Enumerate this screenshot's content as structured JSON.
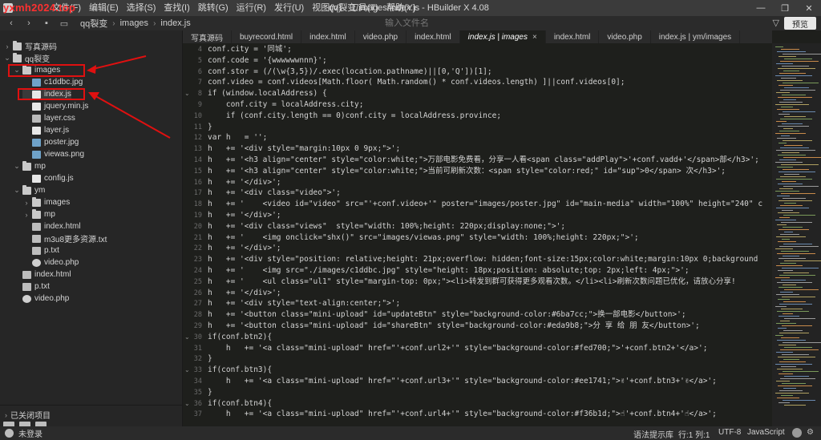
{
  "titlebar": {
    "watermark": "yxmh2024.top",
    "menu": [
      "文件(F)",
      "编辑(E)",
      "选择(S)",
      "查找(I)",
      "跳转(G)",
      "运行(R)",
      "发行(U)",
      "视图(V)",
      "工具(T)",
      "帮助(Y)"
    ],
    "window_title": "qq裂变/images/index.js - HBuilder X 4.08",
    "buttons": [
      "—",
      "❐",
      "✕"
    ]
  },
  "toolbar": {
    "breadcrumb": [
      "qq裂变",
      "images",
      "index.js"
    ],
    "file_input_placeholder": "输入文件名",
    "preview_label": "预览"
  },
  "sidebar": {
    "items": [
      {
        "label": "写真源码",
        "type": "folder",
        "expanded": false,
        "indent": 0
      },
      {
        "label": "qq裂变",
        "type": "folder",
        "expanded": true,
        "indent": 0
      },
      {
        "label": "images",
        "type": "folder",
        "expanded": true,
        "indent": 1
      },
      {
        "label": "c1ddbc.jpg",
        "type": "img",
        "indent": 2
      },
      {
        "label": "index.js",
        "type": "js",
        "indent": 2,
        "selected": true
      },
      {
        "label": "jquery.min.js",
        "type": "js",
        "indent": 2
      },
      {
        "label": "layer.css",
        "type": "css",
        "indent": 2
      },
      {
        "label": "layer.js",
        "type": "js",
        "indent": 2
      },
      {
        "label": "poster.jpg",
        "type": "img",
        "indent": 2
      },
      {
        "label": "viewas.png",
        "type": "img",
        "indent": 2
      },
      {
        "label": "mp",
        "type": "folder",
        "expanded": true,
        "indent": 1
      },
      {
        "label": "config.js",
        "type": "js",
        "indent": 2
      },
      {
        "label": "ym",
        "type": "folder",
        "expanded": true,
        "indent": 1
      },
      {
        "label": "images",
        "type": "folder",
        "expanded": false,
        "indent": 2
      },
      {
        "label": "mp",
        "type": "folder",
        "expanded": false,
        "indent": 2
      },
      {
        "label": "index.html",
        "type": "html",
        "indent": 2
      },
      {
        "label": "m3u8更多资源.txt",
        "type": "txt",
        "indent": 2
      },
      {
        "label": "p.txt",
        "type": "txt",
        "indent": 2
      },
      {
        "label": "video.php",
        "type": "php",
        "indent": 2
      },
      {
        "label": "index.html",
        "type": "html",
        "indent": 1
      },
      {
        "label": "p.txt",
        "type": "txt",
        "indent": 1
      },
      {
        "label": "video.php",
        "type": "php",
        "indent": 1
      }
    ],
    "closed_projects": "已关闭项目"
  },
  "tabs": [
    {
      "label": "写真源码",
      "active": false
    },
    {
      "label": "buyrecord.html",
      "active": false
    },
    {
      "label": "index.html",
      "active": false
    },
    {
      "label": "video.php",
      "active": false
    },
    {
      "label": "index.html",
      "active": false
    },
    {
      "label": "index.js | images",
      "active": true
    },
    {
      "label": "index.html",
      "active": false
    },
    {
      "label": "video.php",
      "active": false
    },
    {
      "label": "index.js | ym/images",
      "active": false
    }
  ],
  "editor": {
    "lines": [
      {
        "n": 4,
        "text": "conf.city = '同城';"
      },
      {
        "n": 5,
        "text": "conf.code = '{wwwwwwnnn}';"
      },
      {
        "n": 6,
        "text": "conf.stor = (/(\\w{3,5})/.exec(location.pathname)||[0,'Q'])[1];"
      },
      {
        "n": 7,
        "text": "conf.video = conf.videos[Math.floor( Math.random() * conf.videos.length) ]||conf.videos[0];"
      },
      {
        "n": 8,
        "text": "if (window.localAddress) {",
        "fold": true
      },
      {
        "n": 9,
        "text": "    conf.city = localAddress.city;"
      },
      {
        "n": 10,
        "text": "    if (conf.city.length == 0)conf.city = localAddress.province;"
      },
      {
        "n": 11,
        "text": "}"
      },
      {
        "n": 12,
        "text": "var h   = '';"
      },
      {
        "n": 13,
        "text": "h   += '<div style=\"margin:10px 0 9px;\">';"
      },
      {
        "n": 14,
        "text": "h   += '<h3 align=\"center\" style=\"color:white;\">万部电影免费看，分享一人看<span class=\"addPlay\">'+conf.vadd+'</span>部</h3>';"
      },
      {
        "n": 15,
        "text": "h   += '<h3 align=\"center\" style=\"color:white;\">当前可刷新次数：<span style=\"color:red;\" id=\"sup\">0</span> 次</h3>';"
      },
      {
        "n": 16,
        "text": "h   += '</div>';"
      },
      {
        "n": 17,
        "text": "h   += '<div class=\"video\">';"
      },
      {
        "n": 18,
        "text": "h   += '    <video id=\"video\" src=\"'+conf.video+'\" poster=\"images/poster.jpg\" id=\"main-media\" width=\"100%\" height=\"240\" c"
      },
      {
        "n": 19,
        "text": "h   += '</div>';"
      },
      {
        "n": 20,
        "text": "h   += '<div class=\"views\"  style=\"width: 100%;height: 220px;display:none;\">';"
      },
      {
        "n": 21,
        "text": "h   += '    <img onclick=\"shx()\" src=\"images/viewas.png\" style=\"width: 100%;height: 220px;\">';"
      },
      {
        "n": 22,
        "text": "h   += '</div>';"
      },
      {
        "n": 23,
        "text": "h   += '<div style=\"position: relative;height: 21px;overflow: hidden;font-size:15px;color:white;margin:10px 0;background"
      },
      {
        "n": 24,
        "text": "h   += '    <img src=\"./images/c1ddbc.jpg\" style=\"height: 18px;position: absolute;top: 2px;left: 4px;\">';"
      },
      {
        "n": 25,
        "text": "h   += '    <ul class=\"ul1\" style=\"margin-top: 0px;\"><li>转发到群可获得更多观看次数。</li><li>刷新次数问题已优化，请放心分享!"
      },
      {
        "n": 26,
        "text": "h   += '</div>';"
      },
      {
        "n": 27,
        "text": "h   += '<div style=\"text-align:center;\">';"
      },
      {
        "n": 28,
        "text": "h   += '<button class=\"mini-upload\" id=\"updateBtn\" style=\"background-color:#6ba7cc;\">换一部电影</button>';"
      },
      {
        "n": 29,
        "text": "h   += '<button class=\"mini-upload\" id=\"shareBtn\" style=\"background-color:#eda9b8;\">分 享 给 朋 友</button>';"
      },
      {
        "n": 30,
        "text": "if(conf.btn2){",
        "fold": true
      },
      {
        "n": 31,
        "text": "    h   += '<a class=\"mini-upload\" href=\"'+conf.url2+'\" style=\"background-color:#fed700;\">'+conf.btn2+'</a>';"
      },
      {
        "n": 32,
        "text": "}"
      },
      {
        "n": 33,
        "text": "if(conf.btn3){",
        "fold": true
      },
      {
        "n": 34,
        "text": "    h   += '<a class=\"mini-upload\" href=\"'+conf.url3+'\" style=\"background-color:#ee1741;\">✌'+conf.btn3+'✌</a>';"
      },
      {
        "n": 35,
        "text": "}"
      },
      {
        "n": 36,
        "text": "if(conf.btn4){",
        "fold": true
      },
      {
        "n": 37,
        "text": "    h   += '<a class=\"mini-upload\" href=\"'+conf.url4+'\" style=\"background-color:#f36b1d;\">☝'+conf.btn4+'☝</a>';"
      }
    ]
  },
  "statusbar": {
    "user": "未登录",
    "hint": "语法提示库",
    "position": "行:1  列:1",
    "encoding": "UTF-8",
    "language": "JavaScript"
  },
  "colors": {
    "annotation_red": "#e01010",
    "editor_bg": "#1e1f1c",
    "sidebar_bg": "#262626"
  }
}
